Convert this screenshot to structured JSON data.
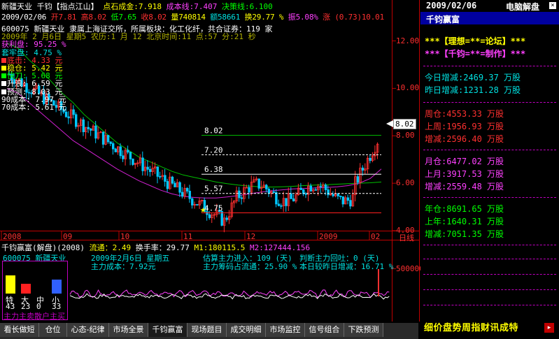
{
  "header": {
    "stock": "新疆天业",
    "tool": "千钧【指点江山】",
    "point_stone_label": "点石成金",
    "point_stone_value": "7.918",
    "cost_label": "成本线",
    "cost_value": "7.407",
    "decision_label": "决策线",
    "decision_value": "6.100"
  },
  "info_bar": {
    "date": "2009/02/06",
    "open": "开7.81",
    "high": "高8.02",
    "low": "低7.65",
    "close": "收8.02",
    "volume": "量740814",
    "amount": "额58661",
    "change_pct": "换29.77 %",
    "amplitude": "振5.08%",
    "rise": "涨 (0.73)10.01"
  },
  "stats": [
    {
      "text": "600075 新疆天业 隶属上海证交所，所属板块：化工化纤，共合证券：119 家",
      "color": "#ffffff"
    },
    {
      "text": "2009年 2 月6日 星期5 农历:1 月 12 北京时间:11 点:57 分:21 秒",
      "color": "#b0b000"
    },
    {
      "text": "获利盘: 95.25 %",
      "color": "#ff40ff"
    },
    {
      "text": "套牢盘: 4.75 %",
      "color": "#00e0e0"
    },
    {
      "text": "底击: 4.33 元",
      "color": "#ff3030",
      "box": "#ff3030"
    },
    {
      "text": "稳仓: 5.42 元",
      "color": "#ffff00",
      "box": "#ffff00"
    },
    {
      "text": "快刀: 5.68 元",
      "color": "#00ff00",
      "box": "#00ff00"
    },
    {
      "text": "升浪: 6.59 元",
      "color": "#ffffff",
      "box": "#ffffff"
    },
    {
      "text": "预测: 8.03 元",
      "color": "#ffffff",
      "box": "#ffffff"
    },
    {
      "text": "90成本: 7.97 元",
      "color": "#ffffff"
    },
    {
      "text": "70成本: 5.61 元",
      "color": "#ffffff"
    }
  ],
  "y_axis_labels": [
    "12.00",
    "10.00",
    "8.00",
    "6.00",
    "4.00"
  ],
  "current_price_tag": "8.02",
  "x_axis_labels": [
    "2008",
    "09",
    "10",
    "11",
    "12",
    "2009",
    "02",
    "日线"
  ],
  "chart_data": {
    "type": "candlestick",
    "ylim": [
      4.0,
      12.9
    ],
    "y_ticks": [
      4,
      6,
      8,
      10,
      12
    ],
    "levels": [
      {
        "label": "8.02",
        "value": 8.02,
        "color": "#00c000",
        "style": "solid"
      },
      {
        "label": "7.20",
        "value": 7.2,
        "color": "#ffffff",
        "style": "dashed"
      },
      {
        "label": "6.38",
        "value": 6.38,
        "color": "#ffffff",
        "style": "solid"
      },
      {
        "label": "5.57",
        "value": 5.57,
        "color": "#ffffff",
        "style": "dashed"
      },
      {
        "label": "4.75",
        "value": 4.75,
        "color": "#ff2020",
        "style": "solid"
      }
    ],
    "green_curve": [
      11.9,
      11.7,
      11.2,
      10.8,
      10.3,
      9.8,
      9.4,
      8.9,
      8.5,
      8.1,
      7.7,
      7.4,
      7.1,
      6.9,
      6.7,
      6.5,
      6.35,
      6.25,
      6.15,
      6.05,
      5.98,
      5.92,
      5.88,
      5.85,
      5.84,
      5.85,
      5.87,
      5.9,
      5.92,
      5.94,
      5.96,
      5.98,
      6.0,
      6.02,
      6.05
    ],
    "magenta_curve": [
      10.0,
      9.8,
      9.4,
      9.0,
      8.6,
      8.2,
      7.8,
      7.5,
      7.2,
      6.9,
      6.6,
      6.35,
      6.1,
      5.9,
      5.7,
      5.55,
      5.45,
      5.4,
      5.38,
      5.38,
      5.42,
      5.48,
      5.55,
      5.62,
      5.68,
      5.72,
      5.76,
      5.78,
      5.8,
      5.82,
      5.85,
      5.9,
      6.0,
      6.2,
      6.6
    ]
  },
  "lower_panel": {
    "title_left": "千钧赢富(解盘)(2008)",
    "float_label": "流通：",
    "float_value": "2.49",
    "turnover_label": "换手率：",
    "turnover_value": "29.77",
    "m1_label": "M1:",
    "m1_value": "180115.5",
    "m2_label": "M2:",
    "m2_value": "127444.156",
    "code": "600075",
    "name": "新疆天业",
    "date_line": "2009年2月6日 星期五",
    "cost_line": "主力成本：7.92元",
    "estimate_line": "估算主力进入：109 (天)",
    "judge_line": "判断主力回吐：0 (天)",
    "chip_line": "主力筹码占流通：25.90 %",
    "change_line": "本日较昨日增减：16.71 %",
    "y_label": "500000",
    "legend": [
      {
        "label": "特",
        "value": "43",
        "color": "#ffff00",
        "height": 0.43
      },
      {
        "label": "大",
        "value": "23",
        "color": "#ff2020",
        "height": 0.23
      },
      {
        "label": "中",
        "value": "0",
        "color": "#00c000",
        "height": 0.0
      },
      {
        "label": "小",
        "value": "33",
        "color": "#3060ff",
        "height": 0.33
      }
    ],
    "legend_caption": "主力主卖散户主买"
  },
  "right_panel": {
    "date": "2009/02/06",
    "title": "电脑解盘",
    "name": "千钧赢富",
    "line1": "***【理想=**=论坛】***",
    "line2": "***【千钧=**=制作】***",
    "today_label": "今日增减:",
    "today_value": "2469.37 万股",
    "yesterday_label": "昨日增减:",
    "yesterday_value": "1231.28 万股",
    "week_label": "周仓:",
    "week_value": "4553.33 万股",
    "lastweek_label": "上周:",
    "lastweek_value": "1956.93 万股",
    "week_delta_label": "增减:",
    "week_delta_value": "2596.40 万股",
    "month_label": "月仓:",
    "month_value": "6477.02 万股",
    "lastmonth_label": "上月:",
    "lastmonth_value": "3917.53 万股",
    "month_delta_label": "增减:",
    "month_delta_value": "2559.48 万股",
    "year_label": "年仓:",
    "year_value": "8691.65 万股",
    "lastyear_label": "上年:",
    "lastyear_value": "1640.31 万股",
    "year_delta_label": "增减:",
    "year_delta_value": "7051.35 万股"
  },
  "tabs": [
    "看长做短",
    "仓位",
    "心态-纪律",
    "市场全景",
    "千钧赢富",
    "现场题目",
    "成交明细",
    "市场监控",
    "信号组合",
    "下跌预测"
  ],
  "side_tabs": "细价盘势周指财讯成特"
}
